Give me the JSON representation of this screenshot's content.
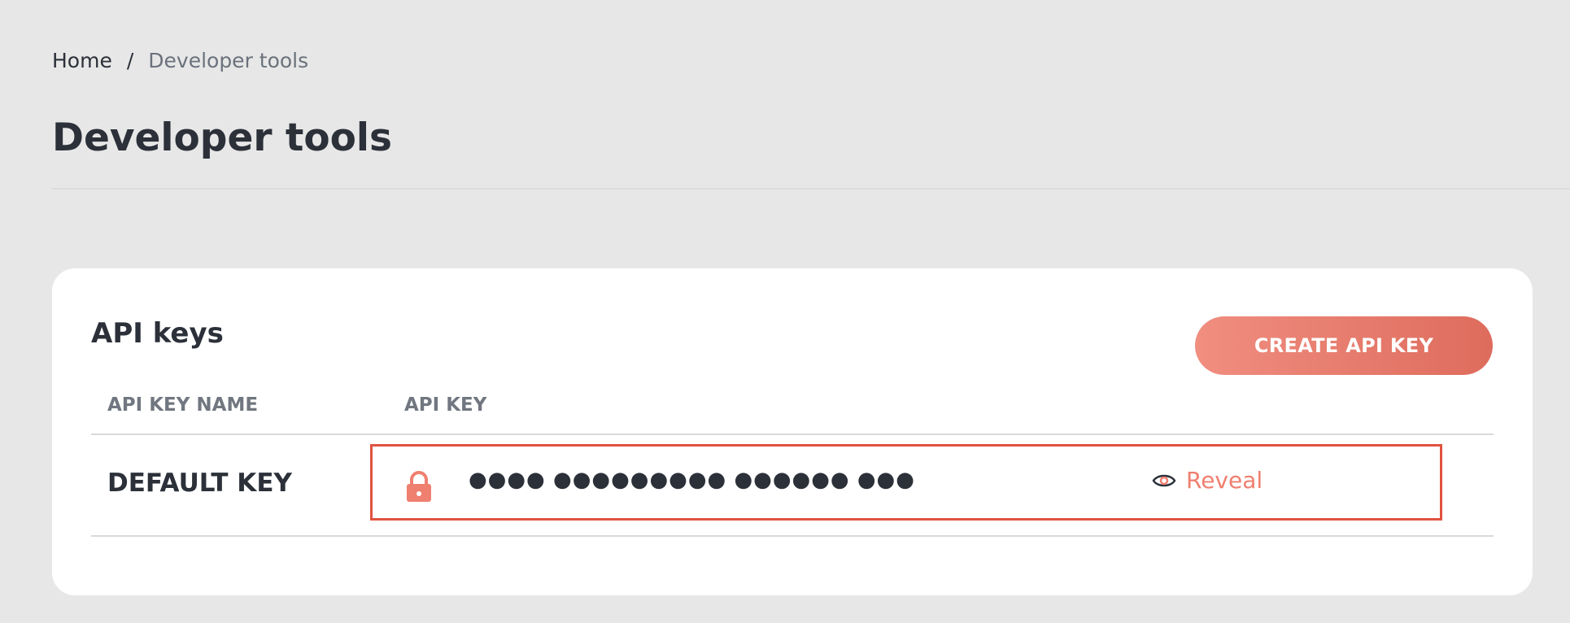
{
  "breadcrumb": {
    "home": "Home",
    "separator": "/",
    "current": "Developer tools"
  },
  "page": {
    "title": "Developer tools"
  },
  "api_keys": {
    "title": "API keys",
    "create_button_label": "CREATE API KEY",
    "columns": {
      "name": "API KEY NAME",
      "key": "API KEY"
    },
    "rows": [
      {
        "name": "DEFAULT KEY",
        "masked_key": "●●●● ●●●●●●●●● ●●●●●● ●●●",
        "reveal_label": "Reveal",
        "lock_icon": "lock-icon",
        "reveal_icon": "eye-icon"
      }
    ]
  },
  "colors": {
    "accent": "#ef7f6f",
    "highlight_border": "#e0533f",
    "button_gradient_start": "#f08e80",
    "button_gradient_end": "#de6c5d",
    "page_background": "#e7e7e7",
    "card_background": "#ffffff",
    "text_primary": "#2b3039",
    "text_muted": "#717780"
  }
}
